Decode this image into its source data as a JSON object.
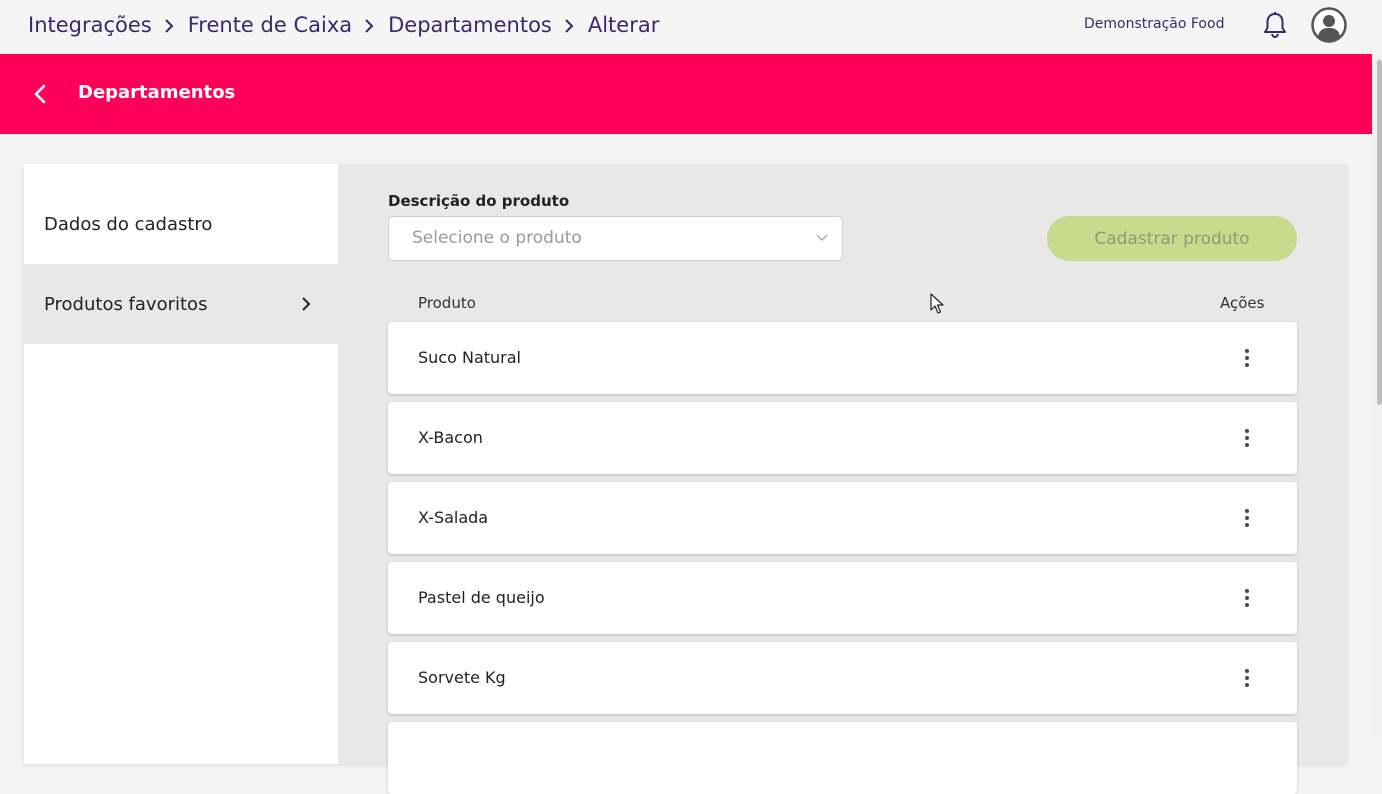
{
  "breadcrumb": {
    "items": [
      "Integrações",
      "Frente de Caixa",
      "Departamentos",
      "Alterar"
    ]
  },
  "header": {
    "company": "Demonstração Food",
    "bell_icon": "bell-icon",
    "avatar_icon": "user-avatar-icon"
  },
  "page": {
    "title": "Departamentos",
    "back_icon": "chevron-left-icon",
    "accent_color": "#ff0059"
  },
  "sidebar": {
    "items": [
      {
        "label": "Dados do cadastro",
        "active": false
      },
      {
        "label": "Produtos favoritos",
        "active": true,
        "icon": "chevron-right-icon"
      }
    ]
  },
  "form": {
    "field_label": "Descrição do produto",
    "select_placeholder": "Selecione o produto",
    "submit_label": "Cadastrar produto",
    "submit_color": "#c6dc8c"
  },
  "table": {
    "headers": {
      "product": "Produto",
      "actions": "Ações"
    },
    "rows": [
      {
        "name": "Suco Natural"
      },
      {
        "name": "X-Bacon"
      },
      {
        "name": "X-Salada"
      },
      {
        "name": "Pastel de queijo"
      },
      {
        "name": "Sorvete Kg"
      },
      {
        "name": ""
      }
    ],
    "action_icon": "more-vertical-icon"
  }
}
